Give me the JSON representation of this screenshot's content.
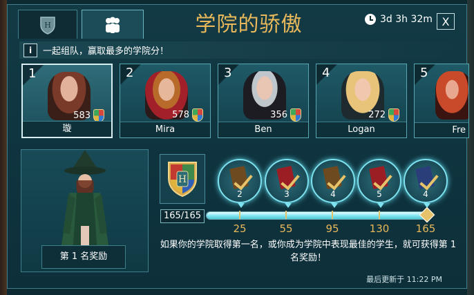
{
  "header": {
    "title": "学院的骄傲",
    "timer": "3d 3h 32m",
    "close_label": "X",
    "tab_icons": [
      "house-crest-icon",
      "team-icon"
    ]
  },
  "info": {
    "icon_label": "i",
    "text": "一起组队，赢取最多的学院分！"
  },
  "members": [
    {
      "rank": "1",
      "name": "璇",
      "points": "583"
    },
    {
      "rank": "2",
      "name": "Mira",
      "points": "578"
    },
    {
      "rank": "3",
      "name": "Ben",
      "points": "356"
    },
    {
      "rank": "4",
      "name": "Logan",
      "points": "272"
    },
    {
      "rank": "5",
      "name": "Fre"
    }
  ],
  "reward": {
    "label": "第 1 名奖励"
  },
  "progress": {
    "value_text": "165/165",
    "fraction": 1.0,
    "milestones": [
      {
        "count": "2",
        "threshold": "25"
      },
      {
        "count": "3",
        "threshold": "55"
      },
      {
        "count": "4",
        "threshold": "95"
      },
      {
        "count": "5",
        "threshold": "130"
      },
      {
        "count": "4",
        "threshold": "165"
      }
    ]
  },
  "description": "如果你的学院取得第一名，或你成为学院中表现最佳的学生，就可获得第 1 名奖励！",
  "footer": {
    "updated": "最后更新于 11:22 PM"
  },
  "colors": {
    "accent_gold": "#e8b85a",
    "panel": "#123a45",
    "glow": "#7ee2f0"
  }
}
